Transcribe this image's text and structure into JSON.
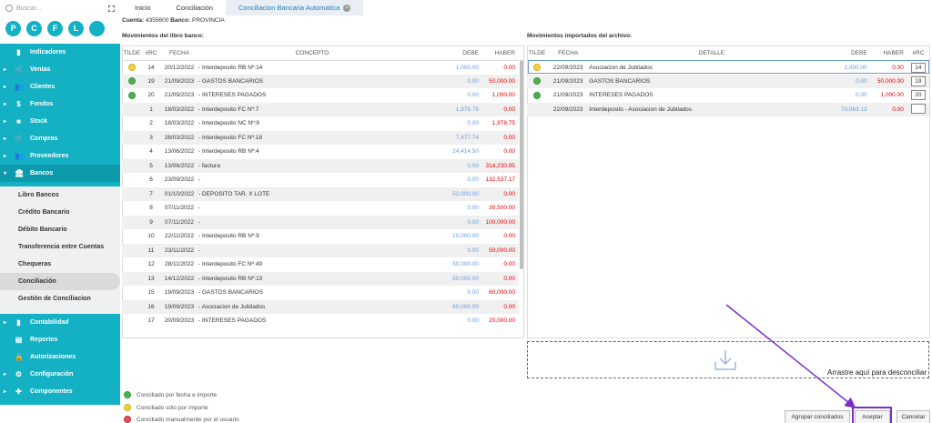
{
  "search": {
    "placeholder": "Buscar..."
  },
  "circles": [
    "P",
    "C",
    "F",
    "L",
    ""
  ],
  "menu_top": [
    {
      "icon": "chart-icon",
      "label": "Indicadores",
      "arrow": ""
    },
    {
      "icon": "cart-icon",
      "label": "Ventas",
      "arrow": "▸"
    },
    {
      "icon": "users-icon",
      "label": "Clientes",
      "arrow": "▸"
    },
    {
      "icon": "dollar-icon",
      "label": "Fondos",
      "arrow": "▸"
    },
    {
      "icon": "box-icon",
      "label": "Stock",
      "arrow": "▸"
    },
    {
      "icon": "cart-plus-icon",
      "label": "Compras",
      "arrow": "▸"
    },
    {
      "icon": "users-icon",
      "label": "Proveedores",
      "arrow": "▸"
    },
    {
      "icon": "bank-icon",
      "label": "Bancos",
      "arrow": "▾"
    }
  ],
  "submenu": [
    "Libro Bancos",
    "Crédito Bancario",
    "Débito Bancario",
    "Transferencia entre Cuentas",
    "Chequeras",
    "Conciliación",
    "Gestión de Conciliacion"
  ],
  "menu_bot": [
    {
      "icon": "book-icon",
      "label": "Contabilidad",
      "arrow": "▸"
    },
    {
      "icon": "report-icon",
      "label": "Reportes",
      "arrow": ""
    },
    {
      "icon": "lock-icon",
      "label": "Autorizaciones",
      "arrow": ""
    },
    {
      "icon": "gear-icon",
      "label": "Configuración",
      "arrow": "▸"
    },
    {
      "icon": "puzzle-icon",
      "label": "Componentes",
      "arrow": "▸"
    }
  ],
  "tabs": [
    "Inicio",
    "Conciliación",
    "Conciliacion Bancaria Automatica"
  ],
  "cuenta": {
    "label": "Cuenta:",
    "value": "4355600",
    "banco_label": "Banco:",
    "banco": "PROVINCIA"
  },
  "left_title": "Movimientos del libro banco:",
  "right_title": "Movimientos importados del archivo:",
  "left_headers": [
    "TILDE",
    "#RC",
    "FECHA",
    "CONCEPTO",
    "DEBE",
    "HABER"
  ],
  "right_headers": [
    "TILDE",
    "FECHA",
    "DETALLE",
    "DEBE",
    "HABER",
    "#RC"
  ],
  "left_rows": [
    {
      "tilde": "y",
      "rc": "14",
      "fecha": "20/12/2022",
      "concepto": " - Interdeposito RB Nº:14",
      "debe": "1,000.00",
      "haber": "0.00"
    },
    {
      "tilde": "g",
      "rc": "19",
      "fecha": "21/09/2023",
      "concepto": " - GASTOS BANCARIOS",
      "debe": "0.00",
      "haber": "50,000.00"
    },
    {
      "tilde": "g",
      "rc": "20",
      "fecha": "21/09/2023",
      "concepto": " - INTERESES PAGADOS",
      "debe": "0.00",
      "haber": "1,000.00"
    },
    {
      "tilde": "",
      "rc": "1",
      "fecha": "18/03/2022",
      "concepto": " - Interdeposito FC Nº:7",
      "debe": "1,978.75",
      "haber": "0.00"
    },
    {
      "tilde": "",
      "rc": "2",
      "fecha": "18/03/2022",
      "concepto": " - Interdeposito NC Nº:8",
      "debe": "0.00",
      "haber": "1,978.75"
    },
    {
      "tilde": "",
      "rc": "3",
      "fecha": "28/03/2022",
      "concepto": " - Interdeposito FC Nº:18",
      "debe": "7,477.74",
      "haber": "0.00"
    },
    {
      "tilde": "",
      "rc": "4",
      "fecha": "13/06/2022",
      "concepto": " - Interdeposito RB Nº:4",
      "debe": "24,414.50",
      "haber": "0.00"
    },
    {
      "tilde": "",
      "rc": "5",
      "fecha": "13/06/2022",
      "concepto": " - factura",
      "debe": "0.00",
      "haber": "314,230.95"
    },
    {
      "tilde": "",
      "rc": "6",
      "fecha": "23/09/2022",
      "concepto": " -",
      "debe": "0.00",
      "haber": "132,537.17"
    },
    {
      "tilde": "",
      "rc": "7",
      "fecha": "01/10/2022",
      "concepto": " - DEPOSITO TAR. X LOTE",
      "debe": "52,000.00",
      "haber": "0.00"
    },
    {
      "tilde": "",
      "rc": "8",
      "fecha": "07/11/2022",
      "concepto": " -",
      "debe": "0.00",
      "haber": "30,500.00"
    },
    {
      "tilde": "",
      "rc": "9",
      "fecha": "07/11/2022",
      "concepto": " -",
      "debe": "0.00",
      "haber": "100,000.00"
    },
    {
      "tilde": "",
      "rc": "10",
      "fecha": "22/11/2022",
      "concepto": " - Interdeposito RB Nº:9",
      "debe": "10,000.00",
      "haber": "0.00"
    },
    {
      "tilde": "",
      "rc": "11",
      "fecha": "23/11/2022",
      "concepto": " -",
      "debe": "0.00",
      "haber": "50,000.00"
    },
    {
      "tilde": "",
      "rc": "12",
      "fecha": "28/11/2022",
      "concepto": " - Interdeposito FC Nº:49",
      "debe": "50,000.00",
      "haber": "0.00"
    },
    {
      "tilde": "",
      "rc": "13",
      "fecha": "14/12/2022",
      "concepto": " - Interdeposito RB Nº:13",
      "debe": "50,000.00",
      "haber": "0.00"
    },
    {
      "tilde": "",
      "rc": "15",
      "fecha": "19/09/2023",
      "concepto": " - GASTOS BANCARIOS",
      "debe": "0.00",
      "haber": "60,000.00"
    },
    {
      "tilde": "",
      "rc": "16",
      "fecha": "19/09/2023",
      "concepto": " - Asociacion de Jubilados",
      "debe": "60,000.00",
      "haber": "0.00"
    },
    {
      "tilde": "",
      "rc": "17",
      "fecha": "20/09/2023",
      "concepto": " - INTERESES PAGADOS",
      "debe": "0.00",
      "haber": "20,000.00"
    }
  ],
  "right_rows": [
    {
      "tilde": "y",
      "fecha": "22/09/2023",
      "detalle": "Asociacion de Jubilados",
      "debe": "1,000.00",
      "haber": "0.00",
      "rc": "14"
    },
    {
      "tilde": "g",
      "fecha": "21/09/2023",
      "detalle": "GASTOS BANCARIOS",
      "debe": "0.00",
      "haber": "50,000.00",
      "rc": "19"
    },
    {
      "tilde": "g",
      "fecha": "21/09/2023",
      "detalle": "INTERESES PAGADOS",
      "debe": "0.00",
      "haber": "1,000.00",
      "rc": "20"
    },
    {
      "tilde": "",
      "fecha": "22/09/2023",
      "detalle": "Interdeposito - Asociacion de Jubilados",
      "debe": "70,063.13",
      "haber": "0.00",
      "rc": ""
    }
  ],
  "drop_label": "Arrastre aquí para desconciliar",
  "legend": [
    {
      "color": "g",
      "text": "Conciliado por fecha e importe"
    },
    {
      "color": "y",
      "text": "Conciliado sólo por importe"
    },
    {
      "color": "r",
      "text": "Conciliado manualmente por el usuario"
    }
  ],
  "buttons": {
    "agrupar": "Agrupar conciliados",
    "aceptar": "Aceptar",
    "cancelar": "Cancelar"
  },
  "colors": {
    "accent": "#14b0c4",
    "annotation": "#7a30c8"
  }
}
